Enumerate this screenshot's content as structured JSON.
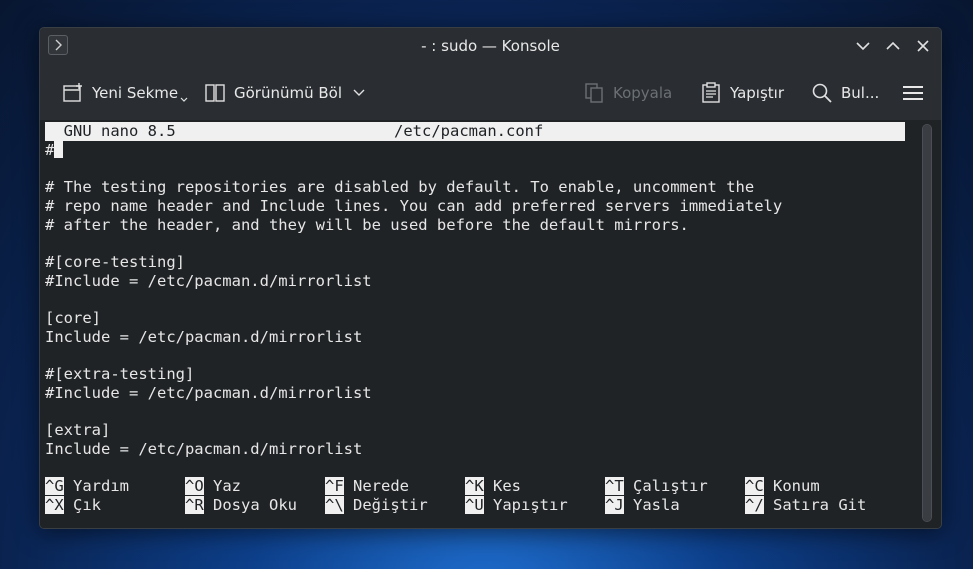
{
  "window": {
    "title": "- : sudo — Konsole"
  },
  "toolbar": {
    "new_tab": "Yeni Sekme",
    "split_view": "Görünümü Böl",
    "copy": "Kopyala",
    "paste": "Yapıştır",
    "find": "Bul..."
  },
  "nano": {
    "header_left": "  GNU nano 8.5",
    "header_file": "/etc/pacman.conf",
    "first_line": "#",
    "lines": [
      "# The testing repositories are disabled by default. To enable, uncomment the",
      "# repo name header and Include lines. You can add preferred servers immediately",
      "# after the header, and they will be used before the default mirrors.",
      "#[core-testing]",
      "#Include = /etc/pacman.d/mirrorlist",
      "[core]",
      "Include = /etc/pacman.d/mirrorlist",
      "#[extra-testing]",
      "#Include = /etc/pacman.d/mirrorlist",
      "[extra]",
      "Include = /etc/pacman.d/mirrorlist"
    ],
    "shortcuts_row1": [
      {
        "key": "^G",
        "label": "Yardım"
      },
      {
        "key": "^O",
        "label": "Yaz"
      },
      {
        "key": "^F",
        "label": "Nerede"
      },
      {
        "key": "^K",
        "label": "Kes"
      },
      {
        "key": "^T",
        "label": "Çalıştır"
      },
      {
        "key": "^C",
        "label": "Konum"
      }
    ],
    "shortcuts_row2": [
      {
        "key": "^X",
        "label": "Çık"
      },
      {
        "key": "^R",
        "label": "Dosya Oku"
      },
      {
        "key": "^\\",
        "label": "Değiştir"
      },
      {
        "key": "^U",
        "label": "Yapıştır"
      },
      {
        "key": "^J",
        "label": "Yasla"
      },
      {
        "key": "^/",
        "label": "Satıra Git"
      }
    ]
  }
}
